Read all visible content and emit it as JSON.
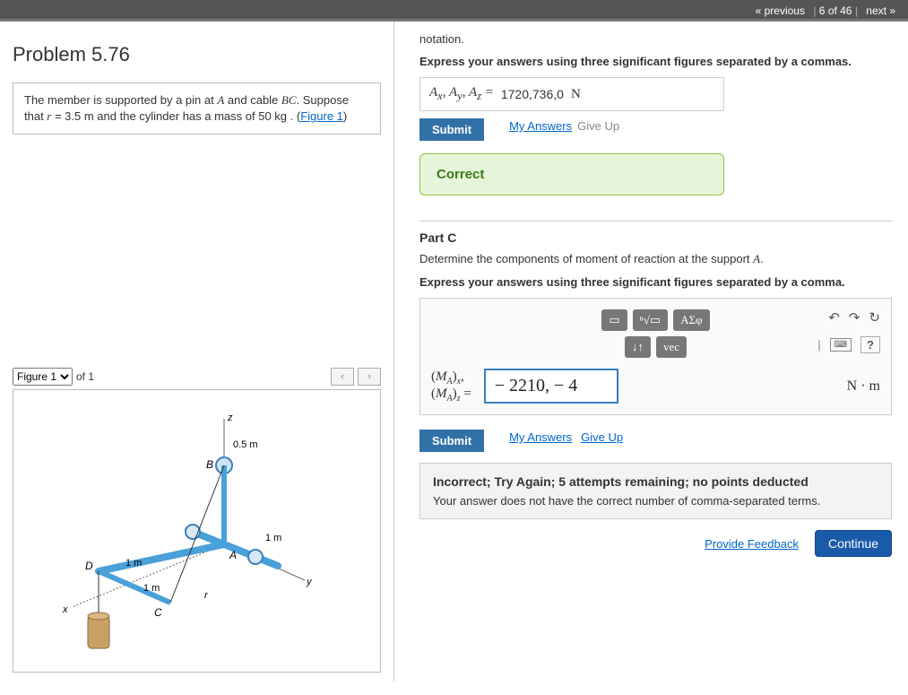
{
  "nav": {
    "prev": "« previous",
    "pos": "6 of 46",
    "next": "next »"
  },
  "problem": {
    "title": "Problem 5.76",
    "desc_pre": "The member is supported by a pin at ",
    "A": "A",
    "desc_mid1": " and cable ",
    "BC": "BC",
    "desc_mid2": ". Suppose that ",
    "r_eq": "r",
    "r_val": " = 3.5  m",
    "desc_mid3": " and the cylinder has a mass of 50  kg . (",
    "fig_link": "Figure 1",
    "desc_end": ")"
  },
  "figure": {
    "selector_label": "Figure 1",
    "of": "of 1",
    "labels": {
      "z": "z",
      "y": "y",
      "x": "x",
      "r": "r",
      "A": "A",
      "B": "B",
      "C": "C",
      "D": "D",
      "dim05": "0.5 m",
      "dim1a": "1 m",
      "dim1b": "1 m",
      "dim1c": "1 m"
    }
  },
  "partB": {
    "notation": "notation.",
    "instruction": "Express your answers using three significant figures separated by a commas.",
    "lhs": "Aₓ, Aᵧ, A_z =",
    "value": "1720,736,0",
    "unit": "N",
    "submit": "Submit",
    "my_answers": "My Answers",
    "give_up": "Give Up",
    "status": "Correct"
  },
  "partC": {
    "title": "Part C",
    "prompt_pre": "Determine the components of moment of reaction at the support ",
    "prompt_A": "A",
    "prompt_post": ".",
    "instruction": "Express your answers using three significant figures separated by a comma.",
    "toolbar": {
      "frac": "▭",
      "sqrt": "√",
      "greek": "ΑΣφ",
      "updown": "↓↑",
      "vec": "vec",
      "undo": "↶",
      "redo": "↷",
      "reset": "↻",
      "kbd": "⌨",
      "help": "?"
    },
    "lhs_line1": "(M_A)ₓ,",
    "lhs_line2": "(M_A)_z",
    "lhs_eq": " =",
    "input_value": "− 2210, − 4",
    "unit": "N · m",
    "submit": "Submit",
    "my_answers": "My Answers",
    "give_up": "Give Up",
    "feedback_title": "Incorrect; Try Again; 5 attempts remaining; no points deducted",
    "feedback_body": "Your answer does not have the correct number of comma-separated terms."
  },
  "footer": {
    "feedback": "Provide Feedback",
    "continue": "Continue"
  }
}
